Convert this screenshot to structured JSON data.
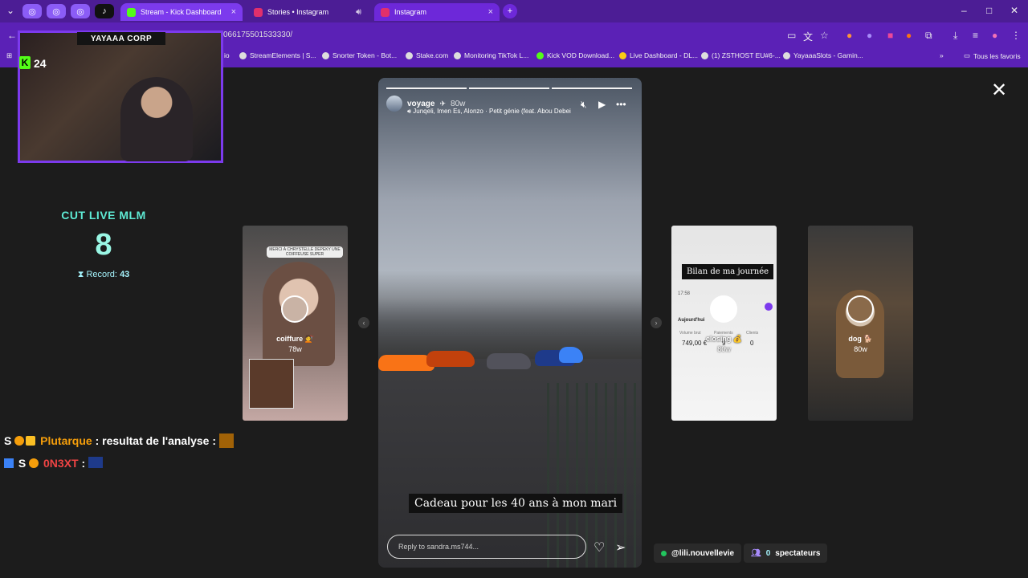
{
  "browser": {
    "tabs": [
      {
        "label": "Stream - Kick Dashboard",
        "close": "×"
      },
      {
        "label": "Stories • Instagram",
        "close": ""
      },
      {
        "label": "Instagram",
        "close": "×"
      }
    ],
    "new_tab": "+",
    "url": "066175501533330/",
    "bookmarks": [
      "io",
      "StreamElements | S...",
      "Snorter Token - Bot...",
      "Stake.com",
      "Monitoring TikTok L...",
      "Kick VOD Download...",
      "Live Dashboard - DL...",
      "(1) ZSTHOST EU#6-...",
      "YayaaaSlots - Gamin..."
    ],
    "bookmarks_more": "»",
    "all_bookmarks": "Tous les favoris",
    "window_controls": {
      "minimize": "–",
      "maximize": "□",
      "close": "✕"
    }
  },
  "cam": {
    "title": "YAYAAA CORP",
    "viewer_count": "24"
  },
  "counter": {
    "title": "CUT LIVE MLM",
    "value": "8",
    "record_label": "Record:",
    "record_value": "43"
  },
  "chat": [
    {
      "prefix": "S",
      "user": "Plutarque",
      "sep": ":",
      "message": "resultat de l'analyse :",
      "user_color": "#f59e0b"
    },
    {
      "prefix": "S",
      "user": "0N3XT",
      "sep": ":",
      "message": "",
      "user_color": "#ef4444"
    }
  ],
  "story": {
    "user": "voyage",
    "age": "80w",
    "music": "Junqeli, Imen Es, Alonzo · Petit génie (feat. Abou Debei",
    "caption": "Cadeau pour les 40 ans à mon mari",
    "reply_placeholder": "Reply to sandra.ms744..."
  },
  "thumbs": [
    {
      "label": "coiffure 💇",
      "age": "78w",
      "header_text": "MERCI À CHRYSTELLE DEPEKY UNE COIFFEUSE SUPER"
    },
    {
      "label": "closing 💰",
      "age": "80w",
      "title": "Bilan de ma journée",
      "time": "17:58",
      "today": "Aujourd'hui",
      "stat_labels": [
        "Volume brut",
        "Paiements",
        "Clients"
      ],
      "stat_values": [
        "749,00 €",
        "9",
        "0"
      ]
    },
    {
      "label": "dog 🐕",
      "age": "80w"
    }
  ],
  "bottom": {
    "user": "@lili.nouvellevie",
    "spectators_count": "0",
    "spectators_label": "spectateurs"
  },
  "close_label": "✕"
}
